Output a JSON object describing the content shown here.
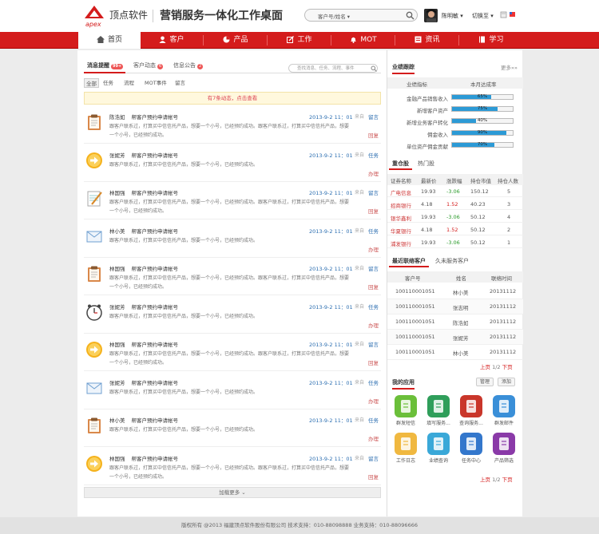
{
  "header": {
    "brand": "顶点软件",
    "title": "营销服务一体化工作桌面",
    "search_select": "客户号/姓名",
    "username": "陈明敏",
    "switch": "切换至"
  },
  "nav": [
    {
      "label": "首页"
    },
    {
      "label": "客户"
    },
    {
      "label": "产品"
    },
    {
      "label": "工作"
    },
    {
      "label": "MOT"
    },
    {
      "label": "资讯"
    },
    {
      "label": "学习"
    }
  ],
  "main": {
    "tabs": [
      {
        "label": "消息提醒",
        "badge": "99+"
      },
      {
        "label": "客户动态",
        "badge": "6"
      },
      {
        "label": "信息公告",
        "badge": "2"
      }
    ],
    "search_placeholder": "查找消息、任务、流程、事件",
    "filters": [
      "全部",
      "任务",
      "流程",
      "MOT事件",
      "留言"
    ],
    "notice": "有7条动态，点击查看",
    "messages": [
      {
        "icon": "clipboard",
        "name": "陈浩如",
        "title": "帮客户预约申请帐号",
        "text": "跟客户联系过，打算买中信信托产品，想要一个小号，已经预约成功。跟客户联系过，打算买中信信托产品，想要一个小号，已经预约成功。",
        "date": "2013-9-2 11：01",
        "src": "来自",
        "act": "留言",
        "act2": "回复"
      },
      {
        "icon": "arrow",
        "name": "张妮芳",
        "title": "帮客户预约申请帐号",
        "text": "跟客户联系过，打算买中信信托产品，想要一个小号，已经预约成功。",
        "date": "2013-9-2 11：01",
        "src": "来自",
        "act": "任务",
        "act2": "办理"
      },
      {
        "icon": "notepad",
        "name": "林国强",
        "title": "帮客户预约申请帐号",
        "text": "跟客户联系过，打算买中信信托产品，想要一个小号，已经预约成功。跟客户联系过，打算买中信信托产品，想要一个小号，已经预约成功。",
        "date": "2013-9-2 11：01",
        "src": "来自",
        "act": "留言",
        "act2": "回复"
      },
      {
        "icon": "mail",
        "name": "林小美",
        "title": "帮客户预约申请帐号",
        "text": "跟客户联系过，打算买中信信托产品，想要一个小号，已经预约成功。",
        "date": "2013-9-2 11：01",
        "src": "来自",
        "act": "任务",
        "act2": "办理"
      },
      {
        "icon": "clipboard",
        "name": "林国强",
        "title": "帮客户预约申请帐号",
        "text": "跟客户联系过，打算买中信信托产品，想要一个小号，已经预约成功。跟客户联系过，打算买中信信托产品，想要一个小号，已经预约成功。",
        "date": "2013-9-2 11：01",
        "src": "来自",
        "act": "留言",
        "act2": "回复"
      },
      {
        "icon": "clock",
        "name": "张妮芳",
        "title": "帮客户预约申请帐号",
        "text": "跟客户联系过，打算买中信信托产品，想要一个小号，已经预约成功。",
        "date": "2013-9-2 11：01",
        "src": "来自",
        "act": "任务",
        "act2": "办理"
      },
      {
        "icon": "arrow",
        "name": "林国强",
        "title": "帮客户预约申请帐号",
        "text": "跟客户联系过，打算买中信信托产品，想要一个小号，已经预约成功。跟客户联系过，打算买中信信托产品，想要一个小号，已经预约成功。",
        "date": "2013-9-2 11：01",
        "src": "来自",
        "act": "留言",
        "act2": "回复"
      },
      {
        "icon": "mail",
        "name": "张妮芳",
        "title": "帮客户预约申请帐号",
        "text": "跟客户联系过，打算买中信信托产品，想要一个小号，已经预约成功。",
        "date": "2013-9-2 11：01",
        "src": "来自",
        "act": "任务",
        "act2": "办理"
      },
      {
        "icon": "clipboard",
        "name": "林小美",
        "title": "帮客户预约申请帐号",
        "text": "跟客户联系过，打算买中信信托产品，想要一个小号，已经预约成功。",
        "date": "2013-9-2 11：01",
        "src": "来自",
        "act": "任务",
        "act2": "办理"
      },
      {
        "icon": "arrow",
        "name": "林国强",
        "title": "帮客户预约申请帐号",
        "text": "跟客户联系过，打算买中信信托产品，想要一个小号，已经预约成功。跟客户联系过，打算买中信信托产品，想要一个小号，已经预约成功。",
        "date": "2013-9-2 11：01",
        "src": "来自",
        "act": "留言",
        "act2": "回复"
      }
    ],
    "load_more": "加载更多"
  },
  "side": {
    "perf_title": "业绩跟踪",
    "more": "更多»»",
    "perf_head": [
      "业绩指标",
      "本月达成率"
    ],
    "perf": [
      {
        "label": "金融产品销售收入",
        "pct": "65%",
        "val": 0.65
      },
      {
        "label": "新增客户资产",
        "pct": "75%",
        "val": 0.75
      },
      {
        "label": "新增业务客户转化",
        "pct": "40%",
        "val": 0.4
      },
      {
        "label": "佣金收入",
        "pct": "90%",
        "val": 0.9
      },
      {
        "label": "单位资产佣金贡献",
        "pct": "70%",
        "val": 0.7
      }
    ],
    "stock_tabs": [
      "重仓股",
      "热门股"
    ],
    "stock_head": [
      "证券名称",
      "最新价",
      "涨跌幅",
      "持仓市值",
      "持仓人数"
    ],
    "stocks": [
      [
        "广电信息",
        "19.93",
        "-3.06",
        "150.12",
        "5"
      ],
      [
        "招商银行",
        "4.18",
        "1.52",
        "40.23",
        "3"
      ],
      [
        "银华鑫利",
        "19.93",
        "-3.06",
        "50.12",
        "4"
      ],
      [
        "华夏银行",
        "4.18",
        "1.52",
        "50.12",
        "2"
      ],
      [
        "浦发银行",
        "19.93",
        "-3.06",
        "50.12",
        "1"
      ]
    ],
    "contact_tabs": [
      "最近联络客户",
      "久未服务客户"
    ],
    "contact_head": [
      "客户号",
      "姓名",
      "联络时间"
    ],
    "contacts": [
      [
        "100110001051",
        "林小美",
        "20131112"
      ],
      [
        "100110001051",
        "张志明",
        "20131112"
      ],
      [
        "100110001051",
        "陈浩如",
        "20131112"
      ],
      [
        "100110001051",
        "张妮芳",
        "20131112"
      ],
      [
        "100110001051",
        "林小美",
        "20131112"
      ]
    ],
    "pager": {
      "prev": "上页",
      "page": "1/2",
      "next": "下页"
    },
    "apps_title": "我的应用",
    "apps_manage": "管理",
    "apps_add": "添加",
    "apps": [
      {
        "label": "群发短信",
        "color": "#6bbf3a"
      },
      {
        "label": "填写服务...",
        "color": "#2f9e5a"
      },
      {
        "label": "查询服务...",
        "color": "#c9362a"
      },
      {
        "label": "群发邮件",
        "color": "#3a8fd8"
      },
      {
        "label": "工作日志",
        "color": "#f0b840"
      },
      {
        "label": "业绩查询",
        "color": "#3aa8d8"
      },
      {
        "label": "任务中心",
        "color": "#3377cc"
      },
      {
        "label": "产品筛选",
        "color": "#8a3aa8"
      }
    ]
  },
  "footer": "版权所有 @2013 福建顶点软件股份有限公司   技术支持：010-88098888   业务支持：010-88096666"
}
